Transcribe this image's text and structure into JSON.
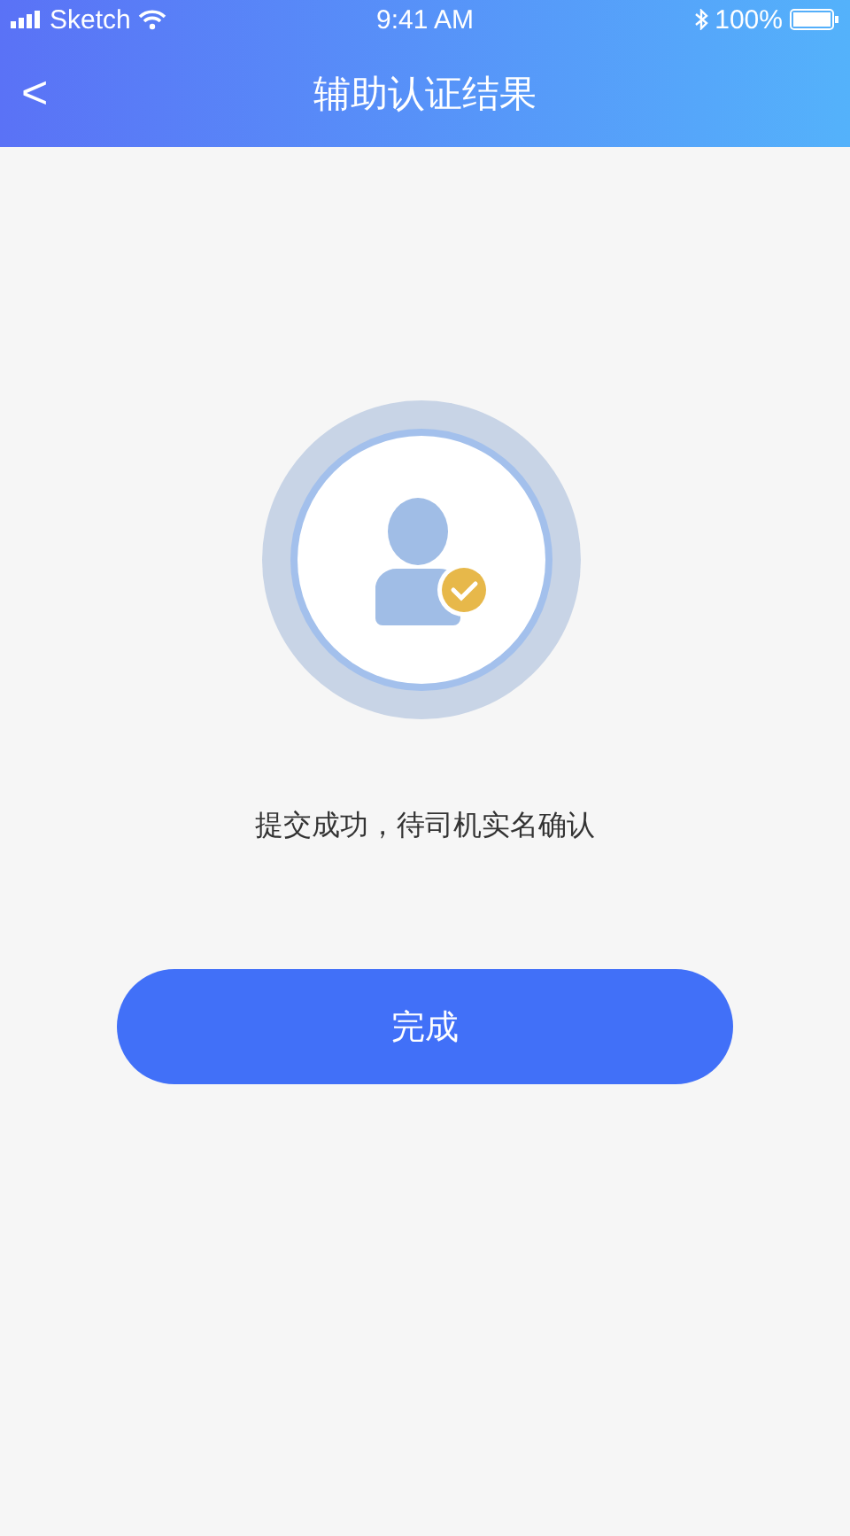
{
  "status_bar": {
    "carrier": "Sketch",
    "time": "9:41 AM",
    "battery": "100%"
  },
  "nav": {
    "title": "辅助认证结果",
    "back": "<"
  },
  "message": "提交成功，待司机实名确认",
  "button": "完成"
}
